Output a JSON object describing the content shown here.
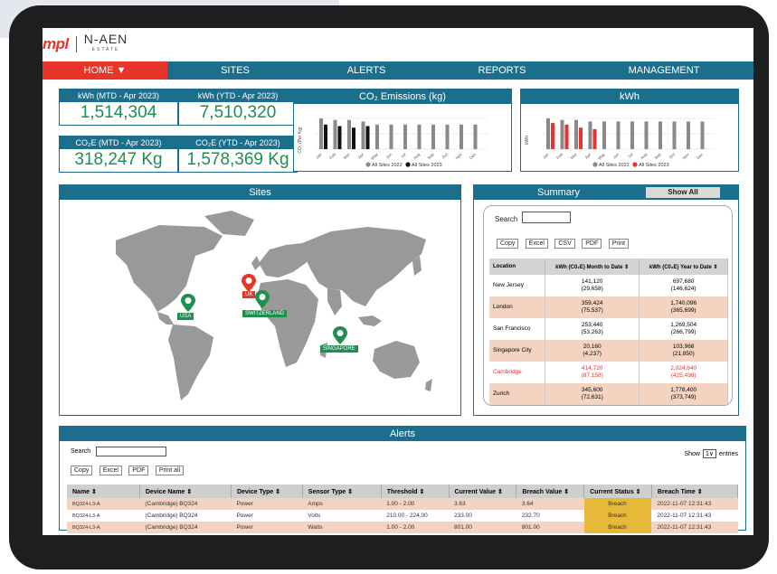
{
  "logo": {
    "brand": "mpl",
    "partner": "N-AEN",
    "partner_sub": "ESTATE"
  },
  "nav": {
    "items": [
      {
        "label": "HOME ▼"
      },
      {
        "label": "SITES"
      },
      {
        "label": "ALERTS"
      },
      {
        "label": "REPORTS"
      },
      {
        "label": "MANAGEMENT"
      }
    ]
  },
  "kpis": [
    {
      "label": "kWh (MTD - Apr 2023)",
      "value": "1,514,304"
    },
    {
      "label": "kWh (YTD - Apr 2023)",
      "value": "7,510,320"
    },
    {
      "label": "CO₂E (MTD - Apr 2023)",
      "value": "318,247 Kg"
    },
    {
      "label": "CO₂E (YTD - Apr 2023)",
      "value": "1,578,369 Kg"
    }
  ],
  "co2_panel": {
    "title": "CO₂ Emissions (kg)",
    "ylabel": "CO₂ (Per Kg)"
  },
  "kwh_panel": {
    "title": "kWh",
    "ylabel": "kWh"
  },
  "chart_data": [
    {
      "type": "bar",
      "title": "CO₂ Emissions (kg)",
      "ylabel": "CO₂ (Per Kg)",
      "categories": [
        "Jan",
        "Feb",
        "Mar",
        "Apr",
        "May",
        "Jun",
        "Jul",
        "Aug",
        "Sep",
        "Oct",
        "Nov",
        "Dec"
      ],
      "series": [
        {
          "name": "All Sites 2022",
          "values": [
            1.0,
            0.95,
            0.95,
            0.9,
            0.8,
            0.8,
            0.8,
            0.8,
            0.8,
            0.8,
            0.8,
            0.8
          ],
          "color": "#8a8a8a"
        },
        {
          "name": "All Sites 2023",
          "values": [
            0.8,
            0.75,
            0.7,
            0.75,
            0,
            0,
            0,
            0,
            0,
            0,
            0,
            0
          ],
          "color": "#111111"
        }
      ]
    },
    {
      "type": "bar",
      "title": "kWh",
      "ylabel": "kWh",
      "categories": [
        "Jan",
        "Feb",
        "Mar",
        "Apr",
        "May",
        "Jun",
        "Jul",
        "Aug",
        "Sep",
        "Oct",
        "Nov",
        "Dec"
      ],
      "series": [
        {
          "name": "All Sites 2022",
          "values": [
            1.0,
            0.95,
            0.95,
            0.9,
            0.9,
            0.9,
            0.9,
            0.9,
            0.9,
            0.9,
            0.9,
            0.9
          ],
          "color": "#8a8a8a"
        },
        {
          "name": "All Sites 2023",
          "values": [
            0.85,
            0.8,
            0.7,
            0.65,
            0,
            0,
            0,
            0,
            0,
            0,
            0,
            0
          ],
          "color": "#e8352a"
        }
      ]
    }
  ],
  "sites": {
    "title": "Sites",
    "pins": [
      {
        "label": "USA",
        "color": "#1e8f4e"
      },
      {
        "label": "UK",
        "color": "#e8352a"
      },
      {
        "label": "SWITZERLAND",
        "color": "#1e8f4e"
      },
      {
        "label": "SINGAPORE",
        "color": "#1e8f4e"
      }
    ]
  },
  "summary": {
    "title": "Summary",
    "show_all": "Show All",
    "search_label": "Search",
    "buttons": [
      "Copy",
      "Excel",
      "CSV",
      "PDF",
      "Print"
    ],
    "columns": [
      "Location",
      "kWh (C0₂E) Month to Date ⇕",
      "kWh (C0₂E) Year to Date ⇕"
    ],
    "rows": [
      {
        "location": "New Jersey",
        "mtd": "141,120",
        "mtd_co2": "(29,658)",
        "ytd": "697,680",
        "ytd_co2": "(146,624)"
      },
      {
        "location": "London",
        "mtd": "359,424",
        "mtd_co2": "(75,537)",
        "ytd": "1,740,096",
        "ytd_co2": "(365,699)"
      },
      {
        "location": "San Francisco",
        "mtd": "253,440",
        "mtd_co2": "(53,263)",
        "ytd": "1,269,504",
        "ytd_co2": "(266,799)"
      },
      {
        "location": "Singapore City",
        "mtd": "20,160",
        "mtd_co2": "(4,237)",
        "ytd": "103,968",
        "ytd_co2": "(21,850)"
      },
      {
        "location": "Cambridge",
        "mtd": "414,720",
        "mtd_co2": "(87,158)",
        "ytd": "2,024,640",
        "ytd_co2": "(425,498)"
      },
      {
        "location": "Zurich",
        "mtd": "345,600",
        "mtd_co2": "(72,631)",
        "ytd": "1,778,400",
        "ytd_co2": "(373,749)"
      }
    ]
  },
  "alerts": {
    "title": "Alerts",
    "search_label": "Search",
    "show_label": "Show",
    "show_value": "1",
    "entries_label": "entries",
    "buttons": [
      "Copy",
      "Excel",
      "PDF",
      "Print all"
    ],
    "columns": [
      "Name ⇕",
      "Device Name ⇕",
      "Device Type ⇕",
      "Sensor Type ⇕",
      "Threshold ⇕",
      "Current Value ⇕",
      "Breach Value ⇕",
      "Current Status ⇕",
      "Breach Time ⇕"
    ],
    "rows": [
      [
        "BQ324-L3-A",
        "(Cambridge) BQ324",
        "Power",
        "Amps",
        "1.00 - 2.00",
        "3.63",
        "3.64",
        "Breach",
        "2022-11-07 12:31:43"
      ],
      [
        "BQ324-L3-A",
        "(Cambridge) BQ324",
        "Power",
        "Volts",
        "210.00 - 224.00",
        "233.00",
        "232.70",
        "Breach",
        "2022-11-07 12:31:43"
      ],
      [
        "BQ324-L3-A",
        "(Cambridge) BQ324",
        "Power",
        "Watts",
        "1.00 - 2.00",
        "801.00",
        "801.00",
        "Breach",
        "2022-11-07 12:31:43"
      ]
    ]
  }
}
